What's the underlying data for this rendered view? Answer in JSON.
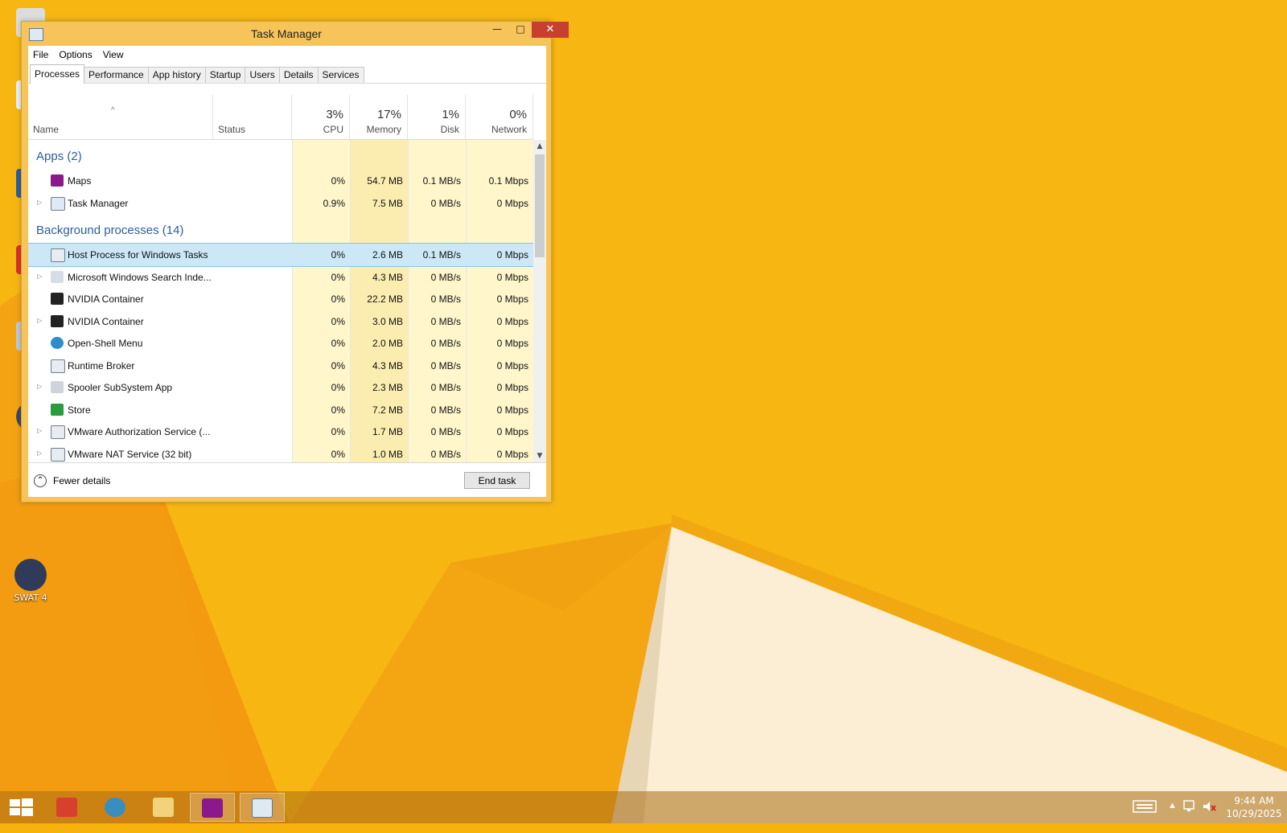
{
  "window": {
    "title": "Task Manager"
  },
  "menu": [
    "File",
    "Options",
    "View"
  ],
  "tabs": [
    "Processes",
    "Performance",
    "App history",
    "Startup",
    "Users",
    "Details",
    "Services"
  ],
  "columns": {
    "name": "Name",
    "status": "Status",
    "cpu": {
      "label": "CPU",
      "pct": "3%"
    },
    "memory": {
      "label": "Memory",
      "pct": "17%"
    },
    "disk": {
      "label": "Disk",
      "pct": "1%"
    },
    "network": {
      "label": "Network",
      "pct": "0%"
    }
  },
  "groups": {
    "apps": "Apps (2)",
    "background": "Background processes (14)"
  },
  "apps": [
    {
      "name": "Maps",
      "cpu": "0%",
      "memory": "54.7 MB",
      "disk": "0.1 MB/s",
      "network": "0.1 Mbps",
      "icon": "maps-icon",
      "expandable": false
    },
    {
      "name": "Task Manager",
      "cpu": "0.9%",
      "memory": "7.5 MB",
      "disk": "0 MB/s",
      "network": "0 Mbps",
      "icon": "task-manager-icon",
      "expandable": true
    }
  ],
  "background": [
    {
      "name": "Host Process for Windows Tasks",
      "cpu": "0%",
      "memory": "2.6 MB",
      "disk": "0.1 MB/s",
      "network": "0 Mbps",
      "icon": "window-app-icon",
      "expandable": false,
      "selected": true
    },
    {
      "name": "Microsoft Windows Search Inde...",
      "cpu": "0%",
      "memory": "4.3 MB",
      "disk": "0 MB/s",
      "network": "0 Mbps",
      "icon": "search-indexer-icon",
      "expandable": true
    },
    {
      "name": "NVIDIA Container",
      "cpu": "0%",
      "memory": "22.2 MB",
      "disk": "0 MB/s",
      "network": "0 Mbps",
      "icon": "nvidia-icon",
      "expandable": false
    },
    {
      "name": "NVIDIA Container",
      "cpu": "0%",
      "memory": "3.0 MB",
      "disk": "0 MB/s",
      "network": "0 Mbps",
      "icon": "nvidia-icon",
      "expandable": true
    },
    {
      "name": "Open-Shell Menu",
      "cpu": "0%",
      "memory": "2.0 MB",
      "disk": "0 MB/s",
      "network": "0 Mbps",
      "icon": "open-shell-icon",
      "expandable": false
    },
    {
      "name": "Runtime Broker",
      "cpu": "0%",
      "memory": "4.3 MB",
      "disk": "0 MB/s",
      "network": "0 Mbps",
      "icon": "window-app-icon",
      "expandable": false
    },
    {
      "name": "Spooler SubSystem App",
      "cpu": "0%",
      "memory": "2.3 MB",
      "disk": "0 MB/s",
      "network": "0 Mbps",
      "icon": "printer-icon",
      "expandable": true
    },
    {
      "name": "Store",
      "cpu": "0%",
      "memory": "7.2 MB",
      "disk": "0 MB/s",
      "network": "0 Mbps",
      "icon": "store-icon",
      "expandable": false
    },
    {
      "name": "VMware Authorization Service (...",
      "cpu": "0%",
      "memory": "1.7 MB",
      "disk": "0 MB/s",
      "network": "0 Mbps",
      "icon": "window-app-icon",
      "expandable": true
    },
    {
      "name": "VMware NAT Service (32 bit)",
      "cpu": "0%",
      "memory": "1.0 MB",
      "disk": "0 MB/s",
      "network": "0 Mbps",
      "icon": "window-app-icon",
      "expandable": true
    }
  ],
  "footer": {
    "fewer_details": "Fewer details",
    "end_task": "End task"
  },
  "desktop": {
    "icons": [
      "SWAT 4"
    ]
  },
  "taskbar": {
    "time": "9:44 AM",
    "date": "10/29/2025"
  },
  "colors": {
    "accent_blue": "#2a5e9e",
    "selection": "#cce8f7",
    "heat_light": "#fff4c4",
    "heat_med": "#f9eba8",
    "desktop_orange": "#f7b20c"
  }
}
